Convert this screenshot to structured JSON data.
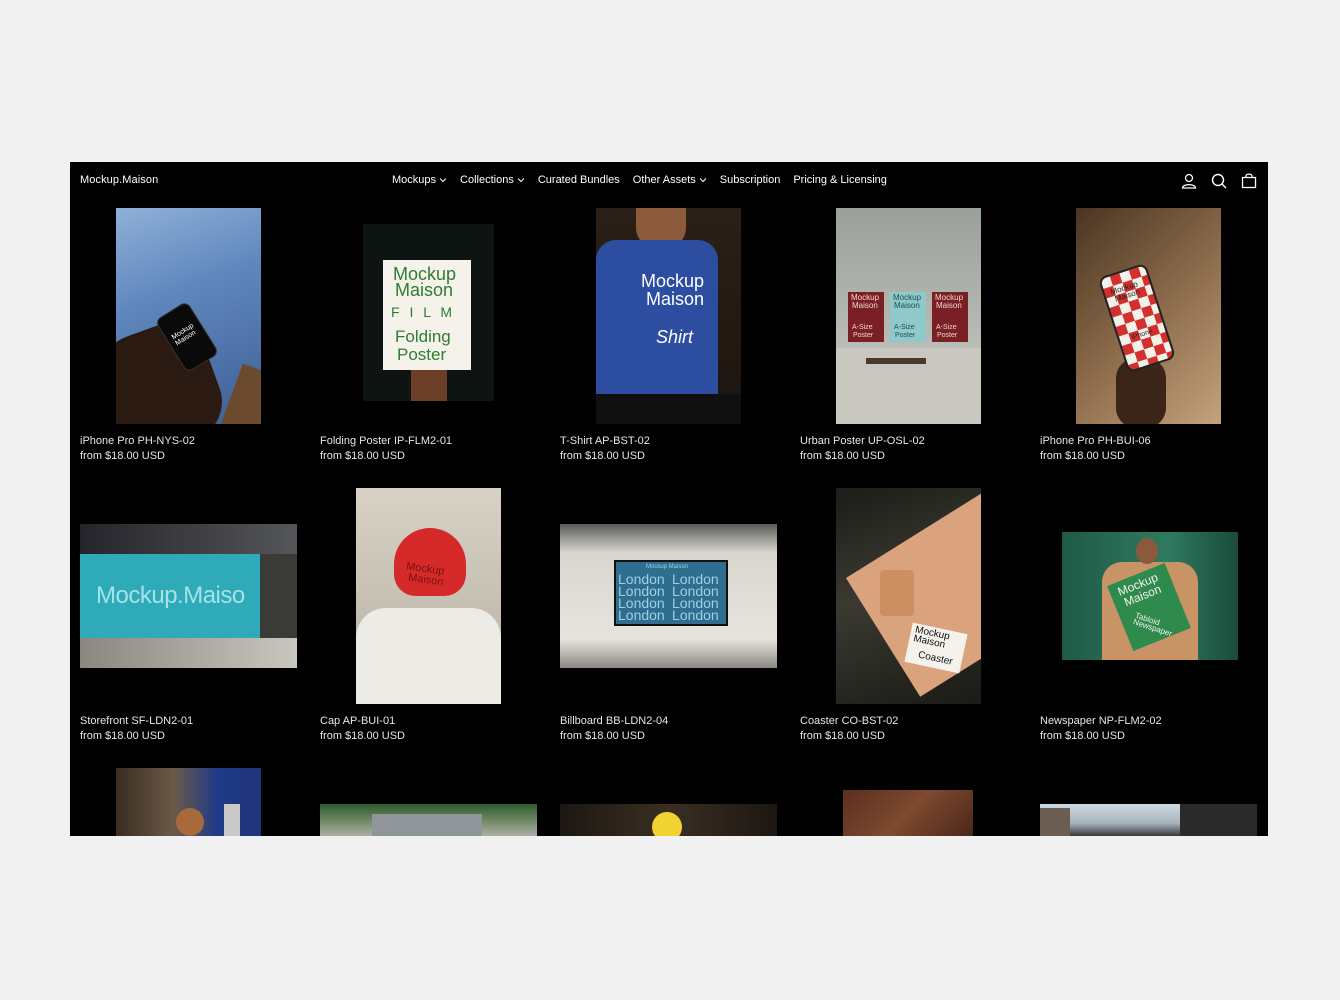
{
  "header": {
    "logo": "Mockup.Maison",
    "nav": [
      {
        "label": "Mockups",
        "dropdown": true
      },
      {
        "label": "Collections",
        "dropdown": true
      },
      {
        "label": "Curated Bundles",
        "dropdown": false
      },
      {
        "label": "Other Assets",
        "dropdown": true
      },
      {
        "label": "Subscription",
        "dropdown": false
      },
      {
        "label": "Pricing & Licensing",
        "dropdown": false
      }
    ],
    "icons": [
      "account-icon",
      "search-icon",
      "cart-icon"
    ]
  },
  "products": [
    {
      "title": "iPhone Pro PH-NYS-02",
      "price": "from $18.00 USD",
      "phone_text": "Mockup Maison"
    },
    {
      "title": "Folding Poster IP-FLM2-01",
      "price": "from $18.00 USD",
      "poster_lines": [
        "Mockup",
        "Maison",
        "F I L M",
        "Folding",
        "Poster"
      ]
    },
    {
      "title": "T-Shirt AP-BST-02",
      "price": "from $18.00 USD",
      "shirt_lines": [
        "Mockup",
        "Maison",
        "Shirt"
      ]
    },
    {
      "title": "Urban Poster UP-OSL-02",
      "price": "from $18.00 USD",
      "poster_lines": [
        "Mockup",
        "Maison",
        "A-Size",
        "Poster"
      ]
    },
    {
      "title": "iPhone Pro PH-BUI-06",
      "price": "from $18.00 USD",
      "phone_lines": [
        "Mockup",
        "Maison",
        "iPhone"
      ]
    },
    {
      "title": "Storefront SF-LDN2-01",
      "price": "from $18.00 USD",
      "sign_text": "Mockup.Maiso"
    },
    {
      "title": "Cap AP-BUI-01",
      "price": "from $18.00 USD",
      "cap_lines": [
        "Mockup",
        "Maison"
      ]
    },
    {
      "title": "Billboard BB-LDN2-04",
      "price": "from $18.00 USD",
      "board_header": "Mockup Maison",
      "board_word": "London"
    },
    {
      "title": "Coaster CO-BST-02",
      "price": "from $18.00 USD",
      "coaster_lines": [
        "Mockup",
        "Maison",
        "Coaster"
      ]
    },
    {
      "title": "Newspaper NP-FLM2-02",
      "price": "from $18.00 USD",
      "paper_lines": [
        "Mockup",
        "Maison",
        "Tabloid",
        "Newspaper"
      ]
    }
  ],
  "colors": {
    "background": "#f1f1f1",
    "site": "#000000",
    "text": "#e6e6e6"
  }
}
